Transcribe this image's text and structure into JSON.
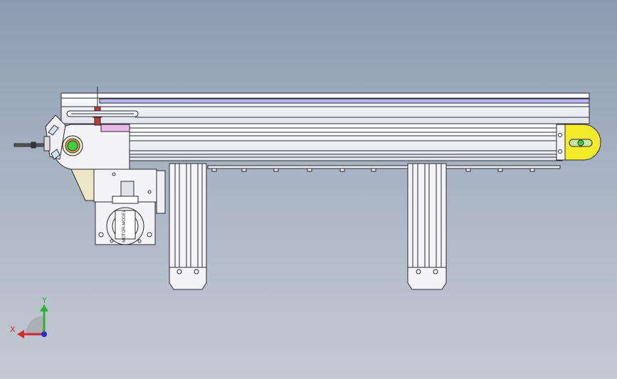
{
  "viewport": {
    "background_top": "#8c9bb0",
    "background_bottom": "#c4cad4"
  },
  "model": {
    "frame_color": "#f4f4f8",
    "line_color": "#2a2a33",
    "belt_accent": "#b9b6f0",
    "end_cap_color": "#f2ea2a",
    "drive_hub_color": "#3ad13a",
    "sensor_color": "#b83a3a",
    "bracket_color": "#ece6c4",
    "pink_block_color": "#e9b8e9",
    "motor_label": "MOTOR-MODEL"
  },
  "triad": {
    "x_label": "X",
    "y_label": "Y",
    "x_color": "#d22a2a",
    "y_color": "#2ab52a",
    "z_color": "#2a2ad2"
  }
}
